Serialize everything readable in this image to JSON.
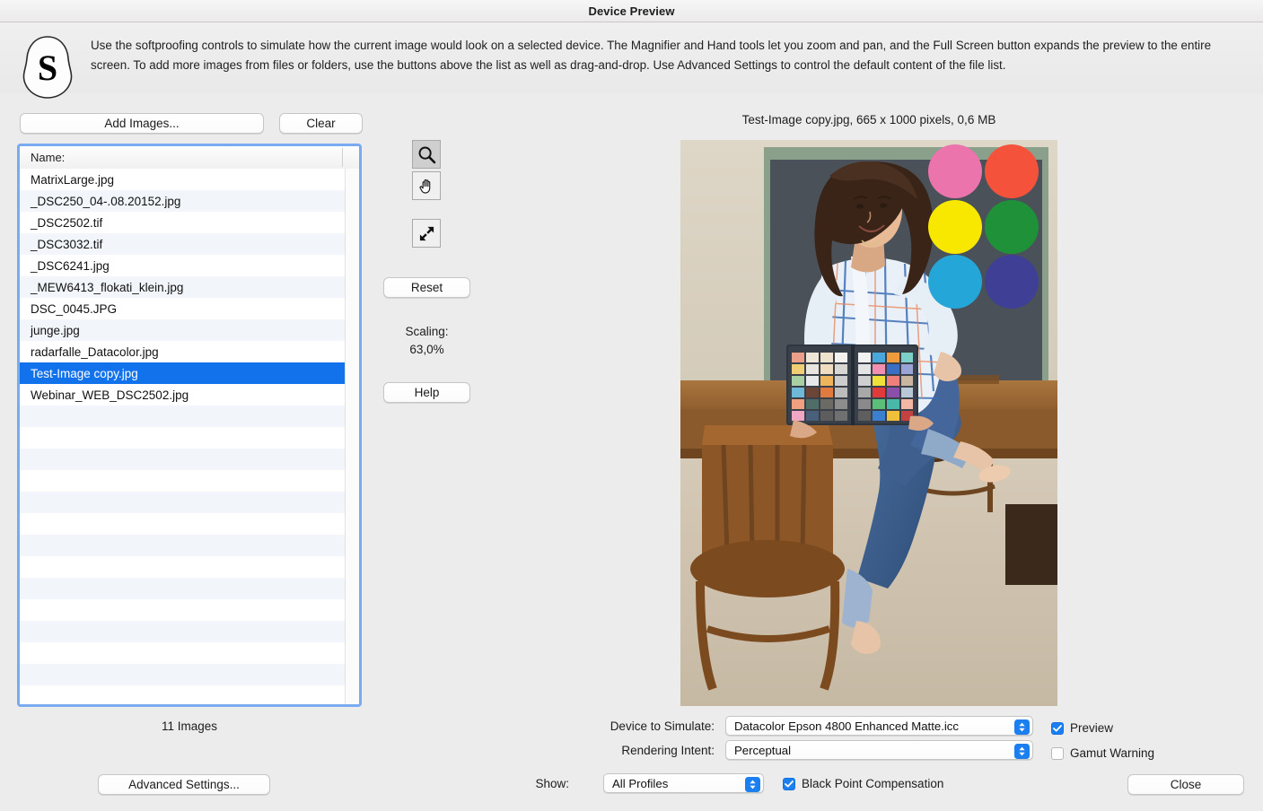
{
  "window": {
    "title": "Device Preview"
  },
  "banner": {
    "icon": "splat-s-logo",
    "text": "Use the softproofing controls to simulate how the current image would look on a selected device. The Magnifier and Hand tools let you zoom and pan, and the Full Screen button expands the preview to the entire screen. To add more images from files or folders, use the buttons above the list as well as drag-and-drop. Use Advanced Settings to control the default content of the file list."
  },
  "file_panel": {
    "add_images_label": "Add Images...",
    "clear_label": "Clear",
    "column_header": "Name:",
    "items": [
      "MatrixLarge.jpg",
      "_DSC250_04-.08.20152.jpg",
      "_DSC2502.tif",
      "_DSC3032.tif",
      "_DSC6241.jpg",
      "_MEW6413_flokati_klein.jpg",
      "DSC_0045.JPG",
      "junge.jpg",
      "radarfalle_Datacolor.jpg",
      "Test-Image copy.jpg",
      "Webinar_WEB_DSC2502.jpg"
    ],
    "selected_index": 9,
    "count_label": "11 Images",
    "advanced_settings_label": "Advanced Settings...",
    "selection_color": "#1272ec",
    "focus_ring_color": "#7aaaf0"
  },
  "tools": {
    "magnifier_icon": "magnifier-icon",
    "hand_icon": "hand-icon",
    "fullscreen_icon": "fullscreen-arrows-icon",
    "active_tool": "magnifier",
    "reset_label": "Reset",
    "help_label": "Help",
    "scaling_title": "Scaling:",
    "scaling_value": "63,0%"
  },
  "preview": {
    "caption": "Test-Image copy.jpg, 665 x 1000 pixels, 0,6 MB",
    "image_description": "Woman in blue plaid shirt and jeans sitting on a wooden table holding a two-panel ColorChecker target, with six large color circles overlaid top-right",
    "swatch_circles": [
      "#ec74ad",
      "#f4523a",
      "#f8e800",
      "#1f9239",
      "#24a7d8",
      "#3f3f96"
    ]
  },
  "controls": {
    "device_label": "Device to Simulate:",
    "device_value": "Datacolor Epson 4800 Enhanced Matte.icc",
    "intent_label": "Rendering Intent:",
    "intent_value": "Perceptual",
    "show_label": "Show:",
    "show_value": "All Profiles",
    "black_point_label": "Black Point Compensation",
    "black_point_checked": true,
    "preview_label": "Preview",
    "preview_checked": true,
    "gamut_label": "Gamut Warning",
    "gamut_checked": false,
    "close_label": "Close",
    "accent_color": "#1c7fef"
  }
}
